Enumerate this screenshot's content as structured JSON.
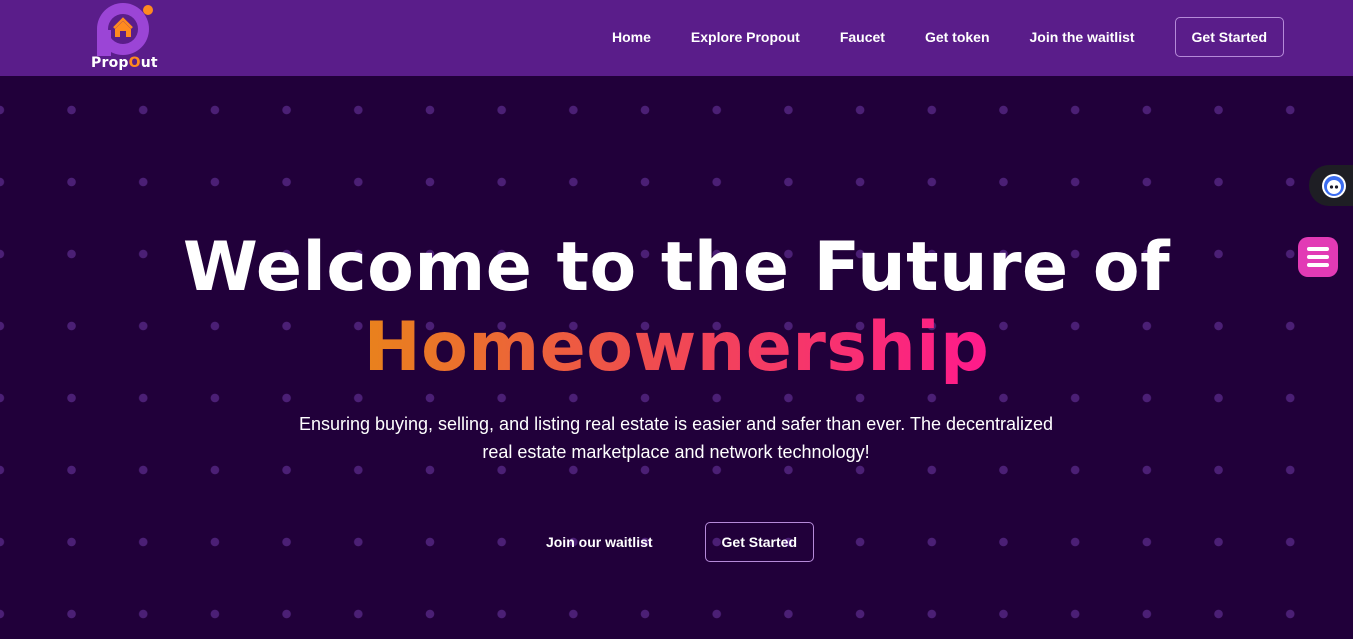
{
  "colors": {
    "nav_bg": "#5a1d8a",
    "hero_bg": "#21003a",
    "dot": "#4b1f75",
    "accent_orange": "#e9821c",
    "accent_pink": "#ff1a8c",
    "menu_button": "#e23ab5"
  },
  "brand": {
    "name_prefix": "Prop",
    "name_o": "O",
    "name_suffix": "ut"
  },
  "nav": {
    "links": [
      "Home",
      "Explore Propout",
      "Faucet",
      "Get token",
      "Join the waitlist"
    ],
    "cta": "Get Started"
  },
  "hero": {
    "title_line1": "Welcome to the Future of",
    "title_line2": "Homeownership",
    "subtitle_line1": "Ensuring buying, selling, and listing real estate is easier and safer than ever. The decentralized",
    "subtitle_line2": "real estate marketplace and network technology!",
    "waitlist_link": "Join our waitlist",
    "cta": "Get Started"
  },
  "icons": {
    "logo": "propout-logo-icon",
    "extension": "assistant-bot-icon",
    "menu": "hamburger-menu-icon"
  }
}
